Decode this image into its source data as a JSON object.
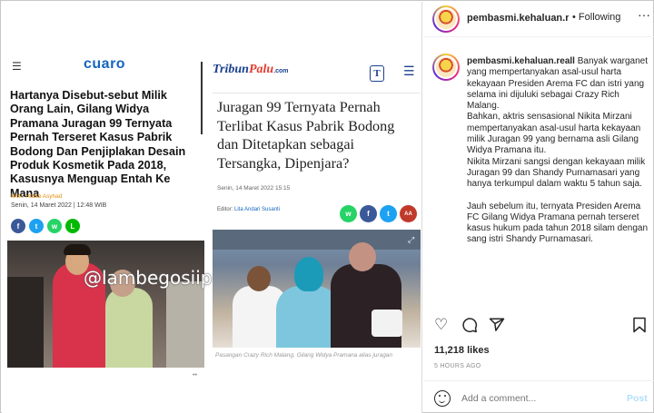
{
  "post": {
    "images": {
      "article_left": {
        "logo": "cuaro",
        "headline": "Hartanya Disebut-sebut Milik Orang Lain, Gilang Widya Pramana Juragan 99 Ternyata Pernah Terseret Kasus Pabrik Bodong Dan Penjiplakan Desain Produk Kosmetik Pada 2018, Kasusnya Menguap Entah Ke Mana",
        "author": "Moh. Habib Asyhad",
        "date": "Senin, 14 Maret 2022 | 12:48 WIB",
        "watermark": "@lambegosiip",
        "share_icons": [
          "facebook-icon",
          "twitter-icon",
          "whatsapp-icon",
          "line-icon"
        ]
      },
      "article_right": {
        "logo_tribun": "Tribun",
        "logo_palu": "Palu",
        "logo_com": ".com",
        "headline": "Juragan 99 Ternyata Pernah Terlibat Kasus Pabrik Bodong dan Ditetapkan sebagai Tersangka, Dipenjara?",
        "date": "Senin, 14 Maret 2022 15:15",
        "editor_label": "Editor:",
        "editor_name": "Lita Andari Susanti",
        "photo_caption": "Pasangan Crazy Rich Malang, Gilang Widya Pramana alias juragan",
        "share_icons": [
          "whatsapp-icon",
          "facebook-icon",
          "twitter-icon",
          "font-size-icon"
        ]
      }
    }
  },
  "sidebar": {
    "username": "pembasmi.kehaluan.re",
    "follow_status": "Following",
    "caption_user": "pembasmi.kehaluan.reall",
    "caption_paragraphs": [
      "Banyak warganet yang mempertanyakan asal-usul harta kekayaan Presiden Arema FC dan istri yang selama ini dijuluki sebagai Crazy Rich Malang.",
      "Bahkan, aktris sensasional Nikita Mirzani mempertanyakan asal-usul harta kekayaan milik Juragan 99 yang bernama asli Gilang Widya Pramana itu.",
      "Nikita Mirzani sangsi dengan kekayaan milik Juragan 99 dan Shandy Purnamasari yang hanya terkumpul dalam waktu 5 tahun saja.",
      "",
      "Jauh sebelum itu, ternyata Presiden Arema FC Gilang Widya Pramana pernah terseret kasus hukum pada tahun 2018 silam dengan sang istri Shandy Purnamasari."
    ],
    "likes": "11,218 likes",
    "time_ago": "5 HOURS AGO",
    "comment_placeholder": "Add a comment...",
    "post_label": "Post"
  }
}
